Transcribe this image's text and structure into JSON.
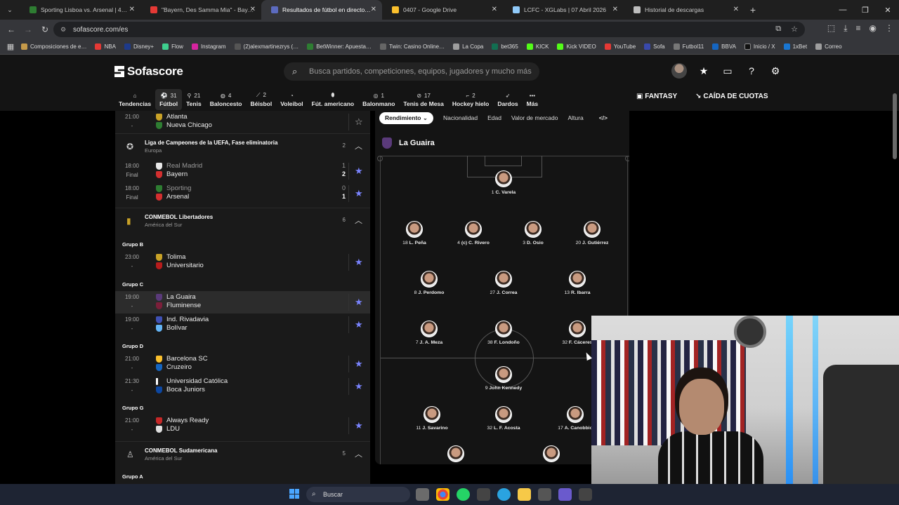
{
  "browser": {
    "tabs": [
      {
        "title": "Sporting Lisboa vs. Arsenal | 4…",
        "color": "#2e7d32",
        "active": false
      },
      {
        "title": "\"Bayern, Des Samma Mia\" - Bay…",
        "color": "#e53935",
        "active": false
      },
      {
        "title": "Resultados de fútbol en directo…",
        "color": "#5c6bc0",
        "active": true
      },
      {
        "title": "0407 - Google Drive",
        "color": "#fbc02d",
        "active": false
      },
      {
        "title": "LCFC - XGLabs | 07 Abril 2026",
        "color": "#90caf9",
        "active": false
      },
      {
        "title": "Historial de descargas",
        "color": "#bdbdbd",
        "active": false
      }
    ],
    "url": "sofascore.com/es",
    "bookmarks": [
      {
        "label": "Composiciones de e…",
        "color": "#c59a4a"
      },
      {
        "label": "NBA",
        "color": "#e53935"
      },
      {
        "label": "Disney+",
        "color": "#1e3a8a"
      },
      {
        "label": "Flow",
        "color": "#3ecf8e"
      },
      {
        "label": "Instagram",
        "color": "#d6249f"
      },
      {
        "label": "(2)alexmartinezrys (…",
        "color": "#222"
      },
      {
        "label": "BetWinner: Apuesta…",
        "color": "#2e7d32"
      },
      {
        "label": "Twin: Casino Online…",
        "color": "#444"
      },
      {
        "label": "La Copa",
        "color": "#9e9e9e"
      },
      {
        "label": "bet365",
        "color": "#126e51"
      },
      {
        "label": "KICK",
        "color": "#53fc18"
      },
      {
        "label": "Kick VIDEO",
        "color": "#53fc18"
      },
      {
        "label": "YouTube",
        "color": "#e53935"
      },
      {
        "label": "Sofa",
        "color": "#3949ab"
      },
      {
        "label": "Futbol11",
        "color": "#777"
      },
      {
        "label": "BBVA",
        "color": "#1565c0"
      },
      {
        "label": "Inicio / X",
        "color": "#111"
      },
      {
        "label": "1xBet",
        "color": "#1976d2"
      },
      {
        "label": "Correo",
        "color": "#9e9e9e"
      }
    ]
  },
  "header": {
    "logo": "Sofascore",
    "search_placeholder": "Busca partidos, competiciones, equipos, jugadores y mucho más",
    "fantasy": "FANTASY",
    "odds": "CAÍDA DE CUOTAS"
  },
  "sports": [
    {
      "label": "Tendencias",
      "count": ""
    },
    {
      "label": "Fútbol",
      "count": "31"
    },
    {
      "label": "Tenis",
      "count": "21"
    },
    {
      "label": "Baloncesto",
      "count": "4"
    },
    {
      "label": "Béisbol",
      "count": "2"
    },
    {
      "label": "Voleibol",
      "count": ""
    },
    {
      "label": "Fút. americano",
      "count": ""
    },
    {
      "label": "Balonmano",
      "count": "1"
    },
    {
      "label": "Tenis de Mesa",
      "count": "17"
    },
    {
      "label": "Hockey hielo",
      "count": "2"
    },
    {
      "label": "Dardos",
      "count": ""
    },
    {
      "label": "Más",
      "count": ""
    }
  ],
  "matches_top": {
    "time": "21:00",
    "status": "-",
    "home": "Atlanta",
    "away": "Nueva Chicago"
  },
  "ucl": {
    "name": "Liga de Campeones de la UEFA, Fase eliminatoria",
    "country": "Europa",
    "count": "2"
  },
  "ucl_matches": [
    {
      "time": "18:00",
      "status": "Final",
      "home": "Real Madrid",
      "away": "Bayern",
      "hs": "1",
      "as": "2"
    },
    {
      "time": "18:00",
      "status": "Final",
      "home": "Sporting",
      "away": "Arsenal",
      "hs": "0",
      "as": "1"
    }
  ],
  "libertadores": {
    "name": "CONMEBOL Libertadores",
    "country": "América del Sur",
    "count": "6"
  },
  "groups": {
    "b": "Grupo B",
    "c": "Grupo C",
    "d": "Grupo D",
    "g": "Grupo G",
    "a": "Grupo A"
  },
  "lib_matches": {
    "b1": {
      "time": "23:00",
      "status": "-",
      "home": "Tolima",
      "away": "Universitario"
    },
    "c1": {
      "time": "19:00",
      "status": "-",
      "home": "La Guaira",
      "away": "Fluminense"
    },
    "c2": {
      "time": "19:00",
      "status": "-",
      "home": "Ind. Rivadavia",
      "away": "Bolívar"
    },
    "d1": {
      "time": "21:00",
      "status": "-",
      "home": "Barcelona SC",
      "away": "Cruzeiro"
    },
    "d2": {
      "time": "21:30",
      "status": "-",
      "home": "Universidad Católica",
      "away": "Boca Juniors"
    },
    "g1": {
      "time": "21:00",
      "status": "-",
      "home": "Always Ready",
      "away": "LDU"
    }
  },
  "sudamericana": {
    "name": "CONMEBOL Sudamericana",
    "country": "América del Sur",
    "count": "5"
  },
  "lineup": {
    "tabs": [
      "Rendimiento",
      "Nacionalidad",
      "Edad",
      "Valor de mercado",
      "Altura"
    ],
    "team": "La Guaira",
    "players": {
      "gk": {
        "num": "1",
        "name": "C. Varela"
      },
      "d1": {
        "num": "18",
        "name": "L. Peña"
      },
      "d2": {
        "num": "4",
        "name": "(c) C. Rivero"
      },
      "d3": {
        "num": "3",
        "name": "D. Osio"
      },
      "d4": {
        "num": "20",
        "name": "J. Gutiérrez"
      },
      "m1": {
        "num": "8",
        "name": "J. Perdomo"
      },
      "m2": {
        "num": "27",
        "name": "J. Correa"
      },
      "m3": {
        "num": "13",
        "name": "R. Ibarra"
      },
      "a1": {
        "num": "7",
        "name": "J. A. Meza"
      },
      "a2": {
        "num": "38",
        "name": "F. Londoño"
      },
      "a3": {
        "num": "32",
        "name": "F. Cáceres"
      },
      "o1": {
        "num": "9",
        "name": "John Kennedy"
      },
      "o2": {
        "num": "11",
        "name": "J. Savarino"
      },
      "o3": {
        "num": "32",
        "name": "L. F. Acosta"
      },
      "o4": {
        "num": "17",
        "name": "A. Canobbio"
      }
    }
  },
  "taskbar": {
    "search": "Buscar"
  }
}
